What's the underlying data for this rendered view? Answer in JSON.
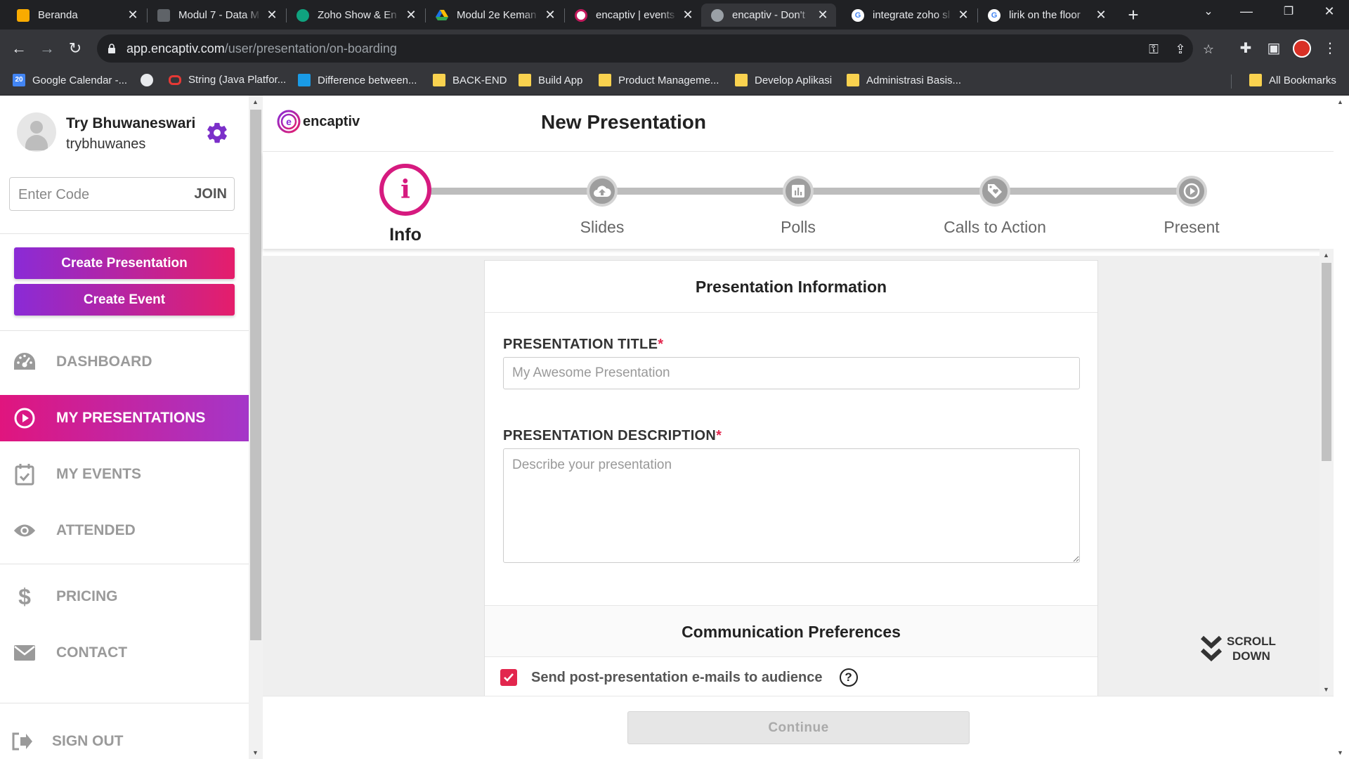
{
  "browser": {
    "tabs": [
      {
        "label": "Beranda",
        "favicon_color": "#f9ab00",
        "active": false
      },
      {
        "label": "Modul 7 - Data M",
        "favicon_color": "#5f6368",
        "active": false
      },
      {
        "label": "Zoho Show & En",
        "favicon_color": "#10a37f",
        "active": false
      },
      {
        "label": "Modul 2e Keman",
        "favicon_color": "#1a73e8",
        "active": false
      },
      {
        "label": "encaptiv | events",
        "favicon_color": "#c2185b",
        "active": false
      },
      {
        "label": "encaptiv - Don't",
        "favicon_color": "#9aa0a6",
        "active": true
      },
      {
        "label": "integrate zoho sl",
        "favicon_color": "#4285f4",
        "active": false
      },
      {
        "label": "lirik on the floor",
        "favicon_color": "#4285f4",
        "active": false
      }
    ],
    "url_host": "app.encaptiv.com",
    "url_path": "/user/presentation/on-boarding",
    "bookmarks": [
      {
        "label": "Google Calendar -...",
        "icon": "calendar-icon"
      },
      {
        "label": "",
        "icon": "globe-icon"
      },
      {
        "label": "String (Java Platfor...",
        "icon": "oracle-icon"
      },
      {
        "label": "Difference between...",
        "icon": "site-icon"
      },
      {
        "label": "BACK-END",
        "icon": "folder-icon"
      },
      {
        "label": "Build App",
        "icon": "folder-icon"
      },
      {
        "label": "Product Manageme...",
        "icon": "folder-icon"
      },
      {
        "label": "Develop Aplikasi",
        "icon": "folder-icon"
      },
      {
        "label": "Administrasi Basis...",
        "icon": "folder-icon"
      }
    ],
    "all_bookmarks": "All Bookmarks"
  },
  "sidebar": {
    "user_name": "Try Bhuwaneswari",
    "user_handle": "trybhuwanes",
    "code_placeholder": "Enter Code",
    "join_label": "JOIN",
    "create_presentation": "Create Presentation",
    "create_event": "Create Event",
    "nav": [
      {
        "label": "DASHBOARD",
        "icon": "dashboard-icon",
        "active": false
      },
      {
        "label": "MY PRESENTATIONS",
        "icon": "play-circle-icon",
        "active": true
      },
      {
        "label": "MY EVENTS",
        "icon": "calendar-check-icon",
        "active": false
      },
      {
        "label": "ATTENDED",
        "icon": "eye-icon",
        "active": false
      },
      {
        "label": "PRICING",
        "icon": "dollar-icon",
        "active": false
      },
      {
        "label": "CONTACT",
        "icon": "envelope-icon",
        "active": false
      },
      {
        "label": "SIGN OUT",
        "icon": "sign-out-icon",
        "active": false
      }
    ]
  },
  "header": {
    "logo_text": "encaptiv",
    "title": "New Presentation"
  },
  "steps": [
    {
      "label": "Info",
      "icon": "info-icon",
      "active": true
    },
    {
      "label": "Slides",
      "icon": "upload-cloud-icon",
      "active": false
    },
    {
      "label": "Polls",
      "icon": "bar-chart-icon",
      "active": false
    },
    {
      "label": "Calls to Action",
      "icon": "tag-heart-icon",
      "active": false
    },
    {
      "label": "Present",
      "icon": "play-icon",
      "active": false
    }
  ],
  "form": {
    "section_title": "Presentation Information",
    "title_label": "PRESENTATION TITLE",
    "title_placeholder": "My Awesome Presentation",
    "description_label": "PRESENTATION DESCRIPTION",
    "description_placeholder": "Describe your presentation",
    "required_mark": "*",
    "comm_title": "Communication Preferences",
    "post_email_label": "Send post-presentation e-mails to audience",
    "post_email_checked": true,
    "help_glyph": "?"
  },
  "scroll_hint": {
    "line1": "SCROLL",
    "line2": "DOWN"
  },
  "footer": {
    "continue_label": "Continue"
  },
  "colors": {
    "brand_pink": "#d61a7f",
    "brand_purple": "#8a2bd6",
    "required": "#e2264d"
  }
}
